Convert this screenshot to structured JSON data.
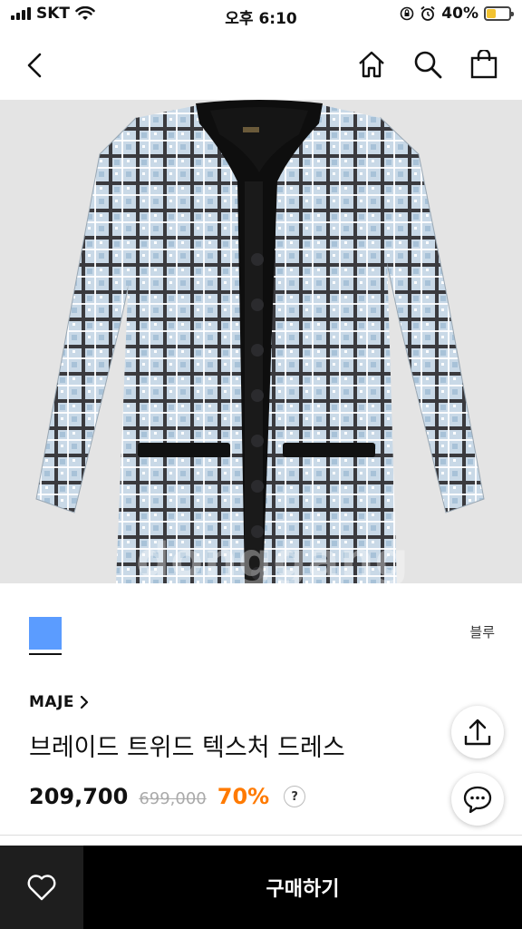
{
  "status_bar": {
    "carrier": "SKT",
    "time": "오후 6:10",
    "battery_percent": "40%",
    "battery_level": 0.4,
    "battery_color": "#f2c230"
  },
  "nav": {
    "back_icon": "chevron-left-icon",
    "icons": [
      "home-icon",
      "search-icon",
      "shopping-bag-icon"
    ]
  },
  "product": {
    "image_icon": "tweed-dress-photo",
    "watermark": "donggang",
    "color_swatch": "#5b9cff",
    "color_name": "블루",
    "brand": "MAJE",
    "name": "브레이드 트위드 텍스처 드레스",
    "price": "209,700",
    "original_price": "699,000",
    "discount": "70%",
    "help": "?"
  },
  "floating": {
    "share_icon": "share-up-arrow-icon",
    "chat_icon": "chat-bubble-icon"
  },
  "bottom_bar": {
    "wish_icon": "heart-icon",
    "buy_label": "구매하기"
  }
}
